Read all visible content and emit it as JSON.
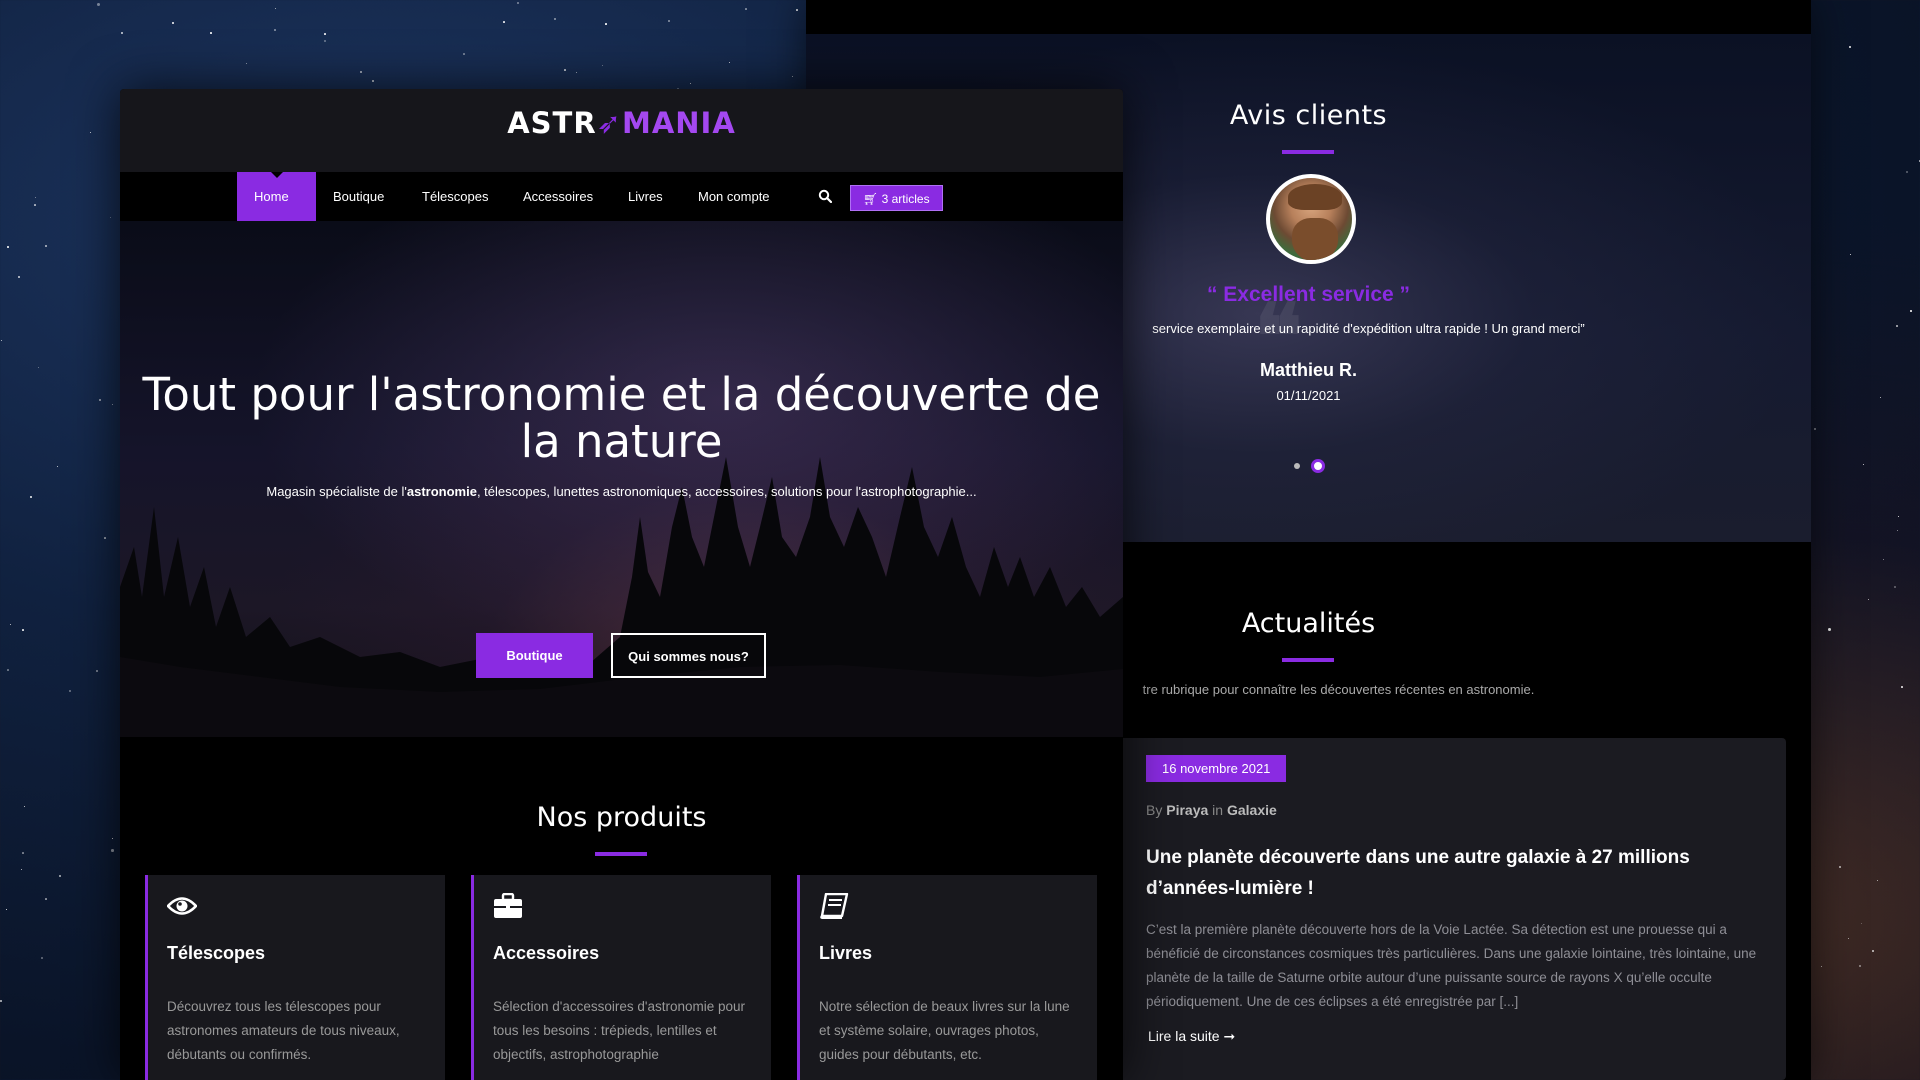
{
  "colors": {
    "accent": "#8a2be2",
    "background": "#000000",
    "card": "#18181d"
  },
  "reviews": {
    "title": "Avis clients",
    "headline": "“ Excellent service ”",
    "text": "service exemplaire et un rapidité d'expédition ultra rapide ! Un grand merci”",
    "author": "Matthieu R.",
    "date": "01/11/2021"
  },
  "news": {
    "title": "Actualités",
    "intro": "tre rubrique pour connaître les découvertes récentes en astronomie.",
    "date": "16 novembre 2021",
    "by_label": "By",
    "author": "Piraya",
    "in_label": "in",
    "category": "Galaxie",
    "heading": "Une planète découverte dans une autre galaxie à 27 millions d’années-lumière !",
    "excerpt": "C’est la première planète découverte hors de la Voie Lactée. Sa détection est une prouesse qui a bénéficié de circonstances cosmiques très particulières. Dans une galaxie lointaine, très lointaine, une planète de la taille de Saturne orbite autour d’une puissante source de rayons X qu’elle occulte périodiquement. Une de ces éclipses a été enregistrée par [...]",
    "read_more": "Lire la suite ➞"
  },
  "header": {
    "logo_left": "ASTR",
    "logo_right": "MANIA",
    "nav": [
      "Home",
      "Boutique",
      "Télescopes",
      "Accessoires",
      "Livres",
      "Mon compte"
    ],
    "cart": "3 articles"
  },
  "hero": {
    "title": "Tout pour l'astronomie et la découverte de la nature",
    "subtitle_before": "Magasin spécialiste de l'",
    "subtitle_bold": "astronomie",
    "subtitle_after": ", télescopes, lunettes astronomiques, accessoires, solutions pour l'astrophotographie...",
    "btn_primary": "Boutique",
    "btn_secondary": "Qui sommes nous?"
  },
  "products": {
    "title": "Nos produits",
    "items": [
      {
        "icon": "eye-icon",
        "title": "Télescopes",
        "text": "Découvrez tous les télescopes pour astronomes amateurs de tous niveaux, débutants ou confirmés."
      },
      {
        "icon": "briefcase-icon",
        "title": "Accessoires",
        "text": "Sélection d'accessoires d'astronomie pour tous les besoins : trépieds, lentilles et objectifs, astrophotographie"
      },
      {
        "icon": "book-icon",
        "title": "Livres",
        "text": "Notre sélection de beaux livres sur la lune et système solaire, ouvrages photos, guides pour débutants, etc."
      }
    ]
  }
}
